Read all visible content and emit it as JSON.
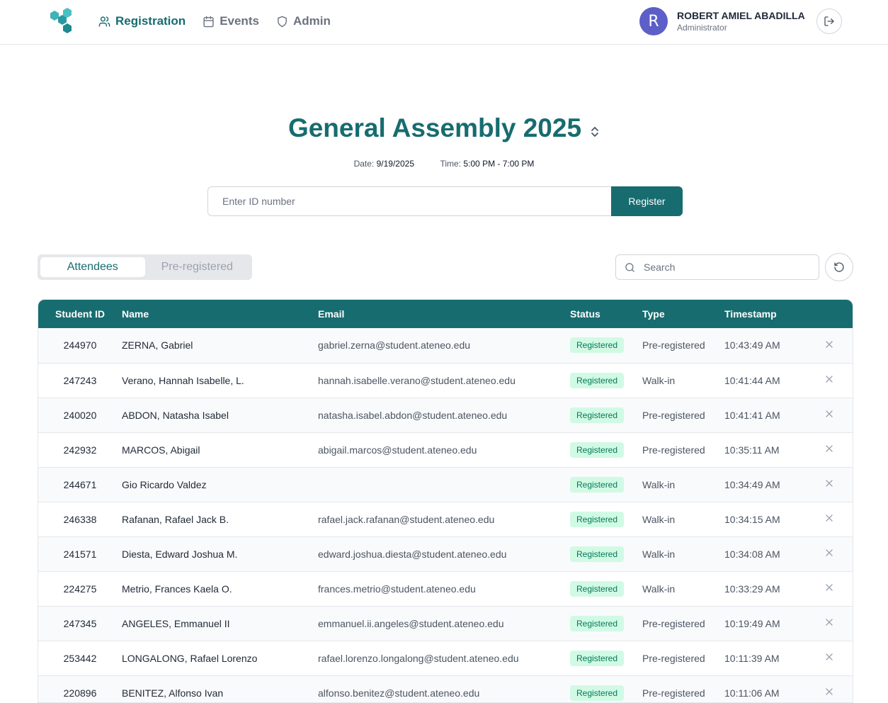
{
  "nav": {
    "items": [
      {
        "label": "Registration",
        "icon": "users-icon",
        "active": true
      },
      {
        "label": "Events",
        "icon": "calendar-icon",
        "active": false
      },
      {
        "label": "Admin",
        "icon": "shield-icon",
        "active": false
      }
    ]
  },
  "user": {
    "initial": "R",
    "name": "ROBERT AMIEL ABADILLA",
    "role": "Administrator"
  },
  "event": {
    "title": "General Assembly 2025",
    "date_label": "Date:",
    "date": "9/19/2025",
    "time_label": "Time:",
    "time": "5:00 PM - 7:00 PM"
  },
  "register": {
    "placeholder": "Enter ID number",
    "button_label": "Register"
  },
  "tabs": {
    "attendees": "Attendees",
    "preregistered": "Pre-registered"
  },
  "search": {
    "placeholder": "Search"
  },
  "table": {
    "headers": {
      "id": "Student ID",
      "name": "Name",
      "email": "Email",
      "status": "Status",
      "type": "Type",
      "timestamp": "Timestamp"
    },
    "rows": [
      {
        "id": "244970",
        "name": "ZERNA, Gabriel",
        "email": "gabriel.zerna@student.ateneo.edu",
        "status": "Registered",
        "type": "Pre-registered",
        "time": "10:43:49 AM"
      },
      {
        "id": "247243",
        "name": "Verano, Hannah Isabelle, L.",
        "email": "hannah.isabelle.verano@student.ateneo.edu",
        "status": "Registered",
        "type": "Walk-in",
        "time": "10:41:44 AM"
      },
      {
        "id": "240020",
        "name": "ABDON, Natasha Isabel",
        "email": "natasha.isabel.abdon@student.ateneo.edu",
        "status": "Registered",
        "type": "Pre-registered",
        "time": "10:41:41 AM"
      },
      {
        "id": "242932",
        "name": "MARCOS, Abigail",
        "email": "abigail.marcos@student.ateneo.edu",
        "status": "Registered",
        "type": "Pre-registered",
        "time": "10:35:11 AM"
      },
      {
        "id": "244671",
        "name": "Gio Ricardo Valdez",
        "email": "",
        "status": "Registered",
        "type": "Walk-in",
        "time": "10:34:49 AM"
      },
      {
        "id": "246338",
        "name": "Rafanan, Rafael Jack B.",
        "email": "rafael.jack.rafanan@student.ateneo.edu",
        "status": "Registered",
        "type": "Walk-in",
        "time": "10:34:15 AM"
      },
      {
        "id": "241571",
        "name": "Diesta, Edward Joshua M.",
        "email": "edward.joshua.diesta@student.ateneo.edu",
        "status": "Registered",
        "type": "Walk-in",
        "time": "10:34:08 AM"
      },
      {
        "id": "224275",
        "name": "Metrio, Frances Kaela O.",
        "email": "frances.metrio@student.ateneo.edu",
        "status": "Registered",
        "type": "Walk-in",
        "time": "10:33:29 AM"
      },
      {
        "id": "247345",
        "name": "ANGELES, Emmanuel II",
        "email": "emmanuel.ii.angeles@student.ateneo.edu",
        "status": "Registered",
        "type": "Pre-registered",
        "time": "10:19:49 AM"
      },
      {
        "id": "253442",
        "name": "LONGALONG, Rafael Lorenzo",
        "email": "rafael.lorenzo.longalong@student.ateneo.edu",
        "status": "Registered",
        "type": "Pre-registered",
        "time": "10:11:39 AM"
      },
      {
        "id": "220896",
        "name": "BENITEZ, Alfonso Ivan",
        "email": "alfonso.benitez@student.ateneo.edu",
        "status": "Registered",
        "type": "Pre-registered",
        "time": "10:11:06 AM"
      }
    ]
  },
  "colors": {
    "accent": "#176c70",
    "badge_bg": "#d1fae5",
    "badge_text": "#047857",
    "avatar": "#5b5fc7"
  }
}
